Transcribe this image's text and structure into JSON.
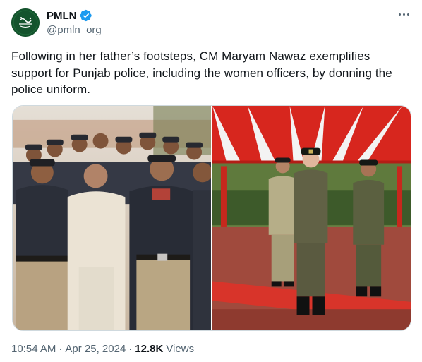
{
  "account": {
    "display_name": "PMLN",
    "handle": "@pmln_org",
    "verified": true,
    "avatar_text": "پاکستان کی جنگ"
  },
  "tweet": {
    "text": "Following in her father’s footsteps, CM Maryam Nawaz exemplifies support for Punjab police, including the women officers, by donning the police uniform."
  },
  "media": {
    "count": 2
  },
  "meta": {
    "time": "10:54 AM",
    "date": "Apr 25, 2024",
    "separator": "·",
    "views_count": "12.8K",
    "views_label": "Views"
  },
  "icons": {
    "more": "more-horizontal-icon",
    "verified": "verified-badge-icon"
  },
  "colors": {
    "verified_blue": "#1d9bf0",
    "text_primary": "#0f1419",
    "text_secondary": "#536471",
    "avatar_bg": "#14532d"
  }
}
